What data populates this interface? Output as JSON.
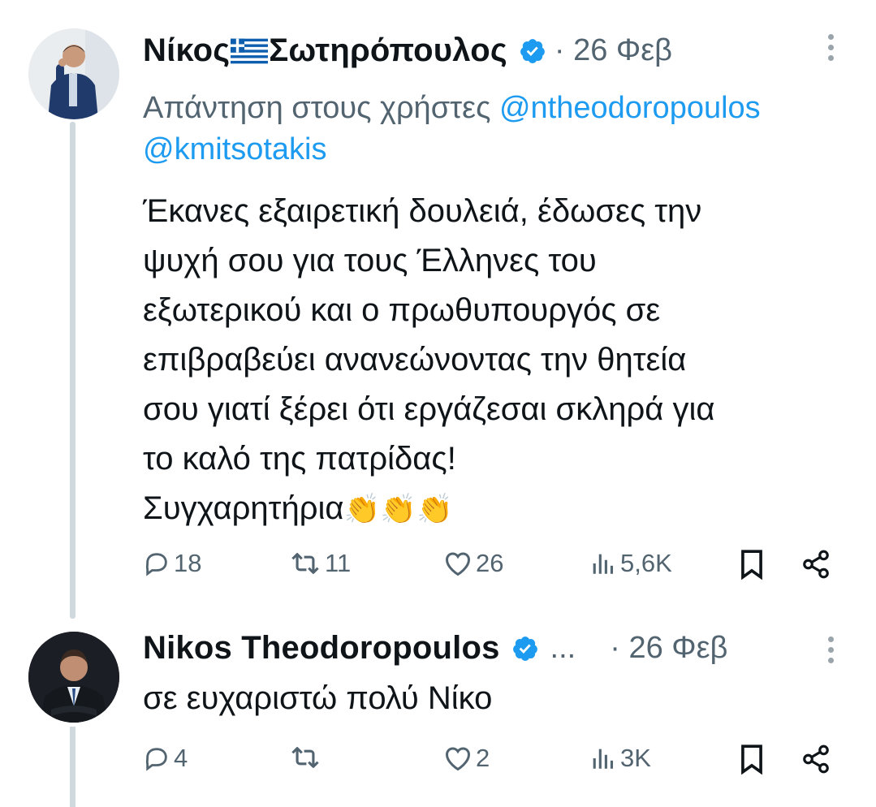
{
  "colors": {
    "text": "#0f1419",
    "secondary": "#536471",
    "link": "#1d9bf0",
    "verified": "#1d9bf0",
    "thread_line": "#cfd9de"
  },
  "tweet1": {
    "name_first": "Νίκος",
    "name_second": "Σωτηρόπουλος",
    "flag_icon": "greece-flag-icon",
    "date": "· 26 Φεβ",
    "replying_prefix": "Απάντηση στους χρήστες ",
    "mention1": "@ntheodoropoulos",
    "mention2": "@kmitsotakis",
    "lines": [
      "Έκανες εξαιρετική δουλειά, έδωσες την",
      "ψυχή σου για τους Έλληνες του",
      "εξωτερικού και ο πρωθυπουργός σε",
      "επιβραβεύει ανανεώνοντας την θητεία",
      "σου γιατί ξέρει ότι εργάζεσαι σκληρά για",
      "το καλό της πατρίδας!"
    ],
    "last_line": "Συγχαρητήρια",
    "emoji": "👏👏👏",
    "replies": "18",
    "retweets": "11",
    "likes": "26",
    "views": "5,6K"
  },
  "tweet2": {
    "name": "Nikos Theodoropoulos",
    "ellipsis": "...",
    "date": "· 26 Φεβ",
    "text": "σε ευχαριστώ πολύ Νίκο",
    "replies": "4",
    "retweets": "",
    "likes": "2",
    "views": "3K"
  }
}
